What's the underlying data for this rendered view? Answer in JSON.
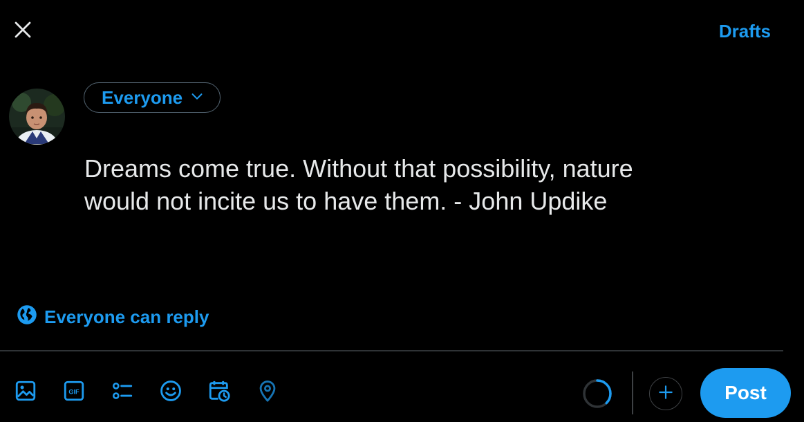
{
  "header": {
    "close_icon": "close-icon",
    "drafts_label": "Drafts"
  },
  "composer": {
    "audience_label": "Everyone",
    "text": "Dreams come true. Without that possibility, nature\nwould not incite us to have them. - John Updike",
    "reply_setting_label": "Everyone can reply"
  },
  "toolbar": {
    "icons": [
      "media-icon",
      "gif-icon",
      "poll-icon",
      "emoji-icon",
      "schedule-icon",
      "location-icon"
    ],
    "post_label": "Post"
  },
  "colors": {
    "accent": "#1d9bf0",
    "background": "#000000",
    "text": "#e7e9ea",
    "border": "#2f3336"
  }
}
